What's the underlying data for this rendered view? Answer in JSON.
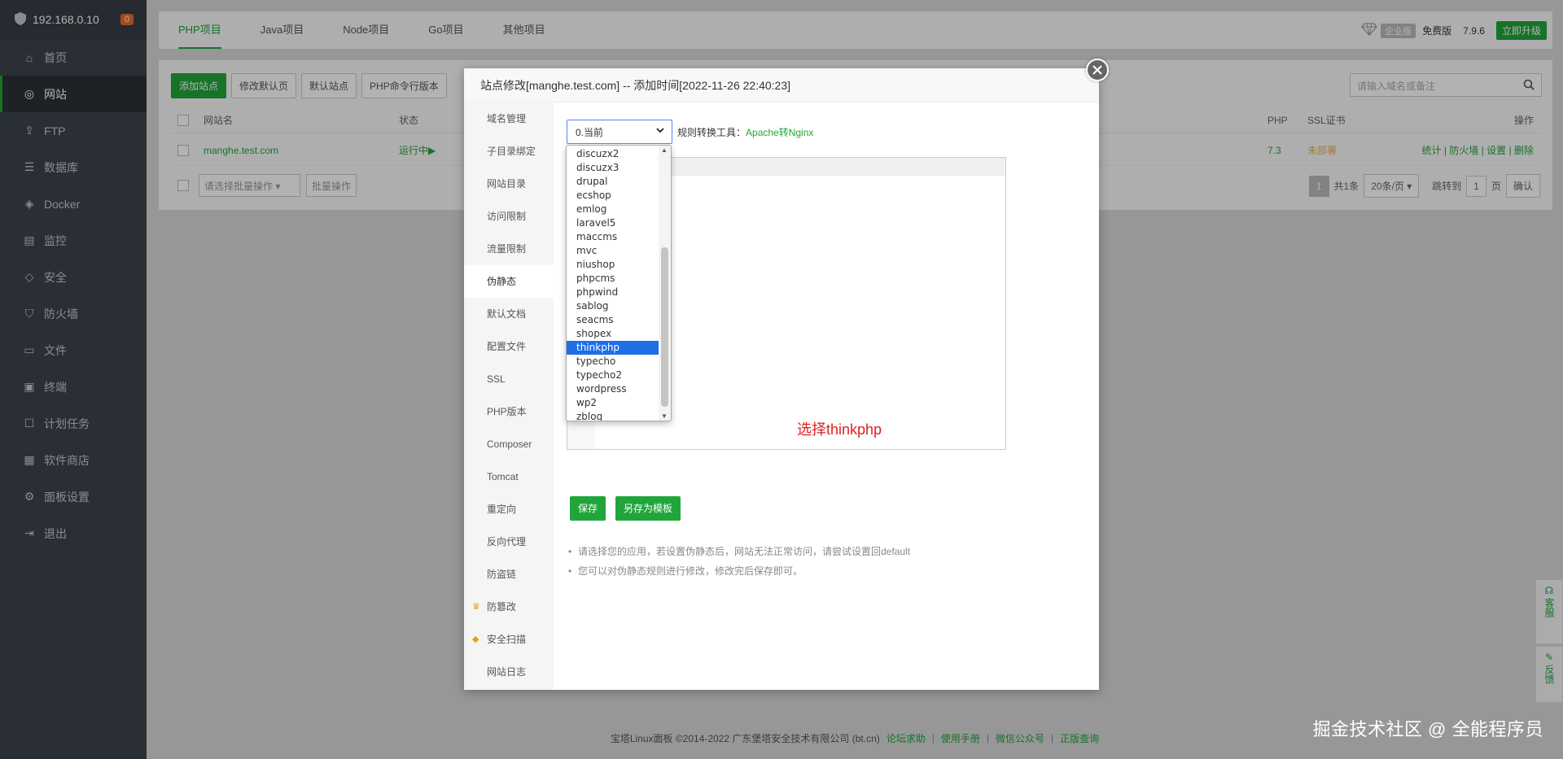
{
  "sidebar": {
    "ip": "192.168.0.10",
    "badge": "0",
    "items": [
      {
        "label": "首页"
      },
      {
        "label": "网站"
      },
      {
        "label": "FTP"
      },
      {
        "label": "数据库"
      },
      {
        "label": "Docker"
      },
      {
        "label": "监控"
      },
      {
        "label": "安全"
      },
      {
        "label": "防火墙"
      },
      {
        "label": "文件"
      },
      {
        "label": "终端"
      },
      {
        "label": "计划任务"
      },
      {
        "label": "软件商店"
      },
      {
        "label": "面板设置"
      },
      {
        "label": "退出"
      }
    ]
  },
  "tabs": [
    {
      "label": "PHP项目"
    },
    {
      "label": "Java项目"
    },
    {
      "label": "Node项目"
    },
    {
      "label": "Go项目"
    },
    {
      "label": "其他项目"
    }
  ],
  "topright": {
    "enterprise": "企业版",
    "free": "免费版",
    "version": "7.9.6",
    "upgrade": "立即升级"
  },
  "toolbar": {
    "add_site": "添加站点",
    "edit_default": "修改默认页",
    "default_site": "默认站点",
    "php_cli": "PHP命令行版本"
  },
  "search": {
    "placeholder": "请输入域名或备注"
  },
  "table": {
    "headers": {
      "name": "网站名",
      "status": "状态",
      "php": "PHP",
      "ssl": "SSL证书",
      "ops": "操作"
    },
    "row": {
      "name": "manghe.test.com",
      "status": "运行中▶",
      "php": "7.3",
      "ssl": "未部署",
      "ops": [
        "统计",
        "防火墙",
        "设置",
        "删除"
      ]
    }
  },
  "batch": {
    "select": "请选择批量操作",
    "button": "批量操作"
  },
  "pager": {
    "current": "1",
    "total": "共1条",
    "per_page": "20条/页",
    "goto": "跳转到",
    "page_input": "1",
    "page_unit": "页",
    "confirm": "确认"
  },
  "footer": {
    "copyright": "宝塔Linux面板 ©2014-2022 广东堡塔安全技术有限公司 (bt.cn)",
    "links": [
      "论坛求助",
      "使用手册",
      "微信公众号",
      "正版查询"
    ]
  },
  "watermark": "掘金技术社区 @ 全能程序员",
  "float": {
    "service": "客服",
    "feedback": "反馈"
  },
  "modal": {
    "title": "站点修改[manghe.test.com] -- 添加时间[2022-11-26 22:40:23]",
    "nav": [
      {
        "label": "域名管理"
      },
      {
        "label": "子目录绑定"
      },
      {
        "label": "网站目录"
      },
      {
        "label": "访问限制"
      },
      {
        "label": "流量限制"
      },
      {
        "label": "伪静态"
      },
      {
        "label": "默认文档"
      },
      {
        "label": "配置文件"
      },
      {
        "label": "SSL"
      },
      {
        "label": "PHP版本"
      },
      {
        "label": "Composer"
      },
      {
        "label": "Tomcat"
      },
      {
        "label": "重定向"
      },
      {
        "label": "反向代理"
      },
      {
        "label": "防盗链"
      },
      {
        "label": "防篡改"
      },
      {
        "label": "安全扫描"
      },
      {
        "label": "网站日志"
      }
    ],
    "rewrite_select": "0.当前",
    "converter_label": "规则转换工具：",
    "converter_link": "Apache转Nginx",
    "hint": "选择thinkphp",
    "save": "保存",
    "save_template": "另存为模板",
    "tips": [
      "请选择您的应用，若设置伪静态后，网站无法正常访问，请尝试设置回default",
      "您可以对伪静态规则进行修改，修改完后保存即可。"
    ],
    "options": [
      "discuzx2",
      "discuzx3",
      "drupal",
      "ecshop",
      "emlog",
      "laravel5",
      "maccms",
      "mvc",
      "niushop",
      "phpcms",
      "phpwind",
      "sablog",
      "seacms",
      "shopex",
      "thinkphp",
      "typecho",
      "typecho2",
      "wordpress",
      "wp2",
      "zblog"
    ],
    "selected_option": "thinkphp"
  },
  "colors": {
    "accent": "#20a53a",
    "sidebar": "#3c444d",
    "hint": "#e02020",
    "select_highlight": "#1e6ee8"
  }
}
